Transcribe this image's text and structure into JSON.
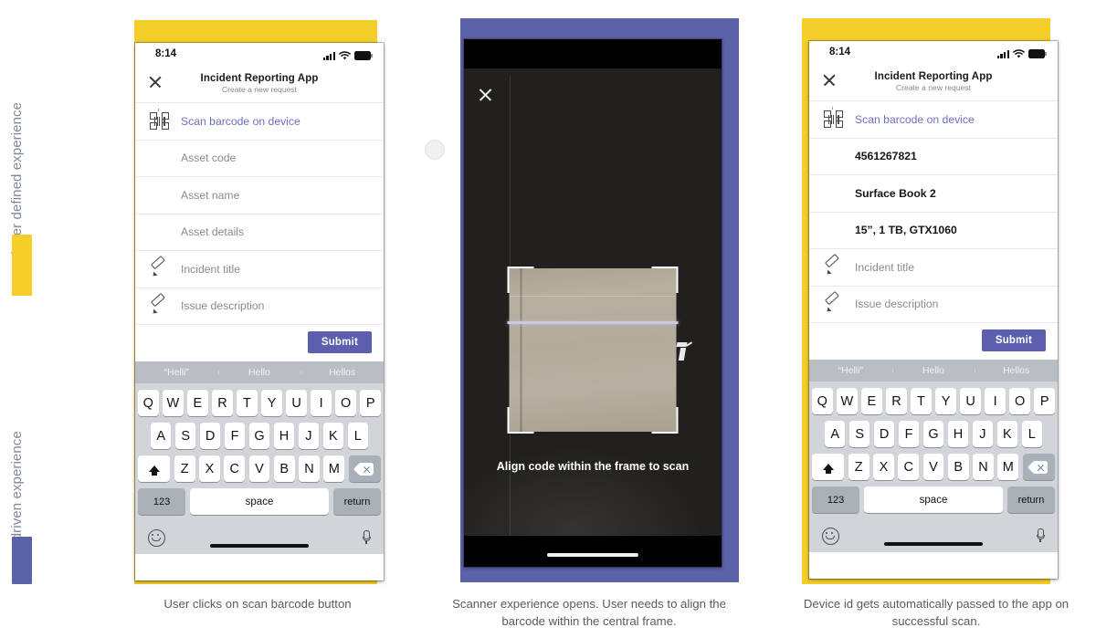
{
  "rail": {
    "labels": [
      {
        "text": "Developer defined experience",
        "color": "#7d8a96"
      },
      {
        "text": "API driven experience",
        "color": "#7d8a96"
      }
    ],
    "bars": [
      {
        "name": "yellow-bar",
        "color": "#F6CE2A"
      },
      {
        "name": "purple-bar",
        "color": "#5C62A8"
      }
    ]
  },
  "panels": {
    "left_bg": "#F6CE2A",
    "middle_bg": "#5C62A8",
    "right_bg": "#F6CE2A"
  },
  "status_bar": {
    "time": "8:14",
    "signal_icon": "signal-bars-icon",
    "wifi_icon": "wifi-icon",
    "battery_icon": "battery-icon"
  },
  "app_header": {
    "close_icon": "close-icon",
    "title": "Incident Reporting App",
    "subtitle": "Create a new request"
  },
  "screen_one": {
    "rows": [
      {
        "icon": "barcode-scan-icon",
        "text": "Scan barcode on device",
        "style": "link"
      },
      {
        "icon": "",
        "text": "Asset code",
        "style": "placeholder"
      },
      {
        "icon": "",
        "text": "Asset name",
        "style": "placeholder"
      },
      {
        "icon": "",
        "text": "Asset details",
        "style": "placeholder"
      },
      {
        "icon": "pencil-icon",
        "text": "Incident title",
        "style": "placeholder"
      },
      {
        "icon": "pencil-icon",
        "text": "Issue description",
        "style": "placeholder"
      }
    ],
    "submit_label": "Submit"
  },
  "screen_three": {
    "rows": [
      {
        "icon": "barcode-scan-icon",
        "text": "Scan barcode on device",
        "style": "link"
      },
      {
        "icon": "",
        "text": "4561267821",
        "style": "filled"
      },
      {
        "icon": "",
        "text": "Surface Book 2",
        "style": "filled"
      },
      {
        "icon": "",
        "text": "15”, 1 TB, GTX1060",
        "style": "filled"
      },
      {
        "icon": "pencil-icon",
        "text": "Incident title",
        "style": "placeholder"
      },
      {
        "icon": "pencil-icon",
        "text": "Issue description",
        "style": "placeholder"
      }
    ],
    "submit_label": "Submit"
  },
  "keyboard": {
    "suggestions": [
      "“Helli”",
      "Hello",
      "Hellos"
    ],
    "row1": [
      "Q",
      "W",
      "E",
      "R",
      "T",
      "Y",
      "U",
      "I",
      "O",
      "P"
    ],
    "row2": [
      "A",
      "S",
      "D",
      "F",
      "G",
      "H",
      "J",
      "K",
      "L"
    ],
    "row3": [
      "Z",
      "X",
      "C",
      "V",
      "B",
      "N",
      "M"
    ],
    "shift_icon": "shift-icon",
    "backspace_icon": "backspace-icon",
    "numbers_label": "123",
    "space_label": "space",
    "return_label": "return",
    "emoji_icon": "emoji-icon",
    "mic_icon": "microphone-icon",
    "accent": "#5b5fad"
  },
  "scanner": {
    "close_icon": "close-icon",
    "torch_icon": "flashlight-icon",
    "hint": "Align code within the frame to scan",
    "frame_icon": "scan-frame-corners"
  },
  "captions": [
    "User clicks on scan barcode button",
    "Scanner experience opens. User needs to align the barcode within the central frame.",
    "Device id gets automatically passed to the app on successful scan."
  ]
}
